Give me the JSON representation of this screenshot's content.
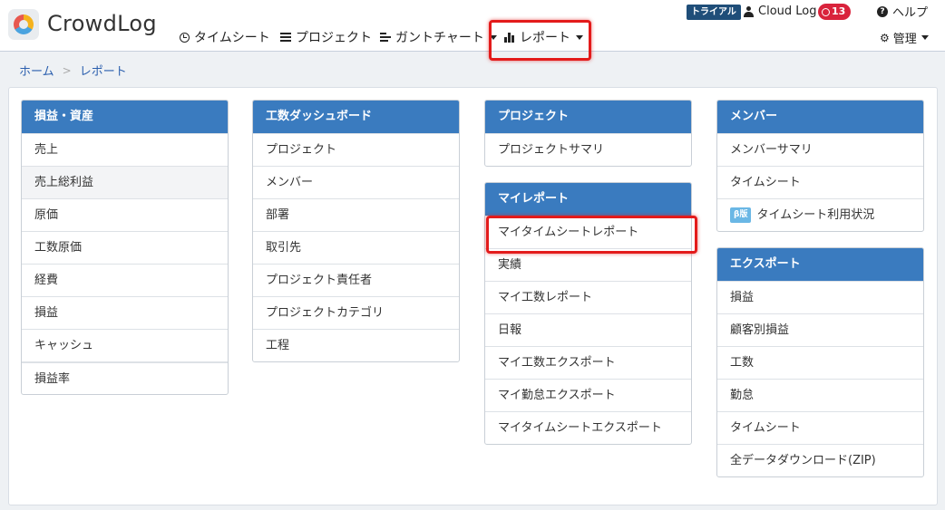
{
  "brand": {
    "name": "CrowdLog"
  },
  "nav": {
    "timesheet": "タイムシート",
    "project": "プロジェクト",
    "gantt": "ガントチャート",
    "report": "レポート"
  },
  "header": {
    "trial": "トライアル",
    "user": "Cloud Log",
    "badge_count": "13",
    "help": "ヘルプ",
    "admin": "管理"
  },
  "breadcrumb": {
    "home": "ホーム",
    "sep": ">",
    "current": "レポート"
  },
  "groups": {
    "pl": {
      "title": "損益・資産",
      "items": [
        "売上",
        "売上総利益",
        "原価",
        "工数原価",
        "経費",
        "損益",
        "キャッシュ",
        "損益率"
      ]
    },
    "dashboard": {
      "title": "工数ダッシュボード",
      "items": [
        "プロジェクト",
        "メンバー",
        "部署",
        "取引先",
        "プロジェクト責任者",
        "プロジェクトカテゴリ",
        "工程"
      ]
    },
    "project": {
      "title": "プロジェクト",
      "items": [
        "プロジェクトサマリ"
      ]
    },
    "myreport": {
      "title": "マイレポート",
      "items": [
        "マイタイムシートレポート",
        "実績",
        "マイ工数レポート",
        "日報",
        "マイ工数エクスポート",
        "マイ勤怠エクスポート",
        "マイタイムシートエクスポート"
      ]
    },
    "member": {
      "title": "メンバー",
      "items": [
        "メンバーサマリ",
        "タイムシート",
        "タイムシート利用状況"
      ],
      "beta_label": "β版"
    },
    "export": {
      "title": "エクスポート",
      "items": [
        "損益",
        "顧客別損益",
        "工数",
        "勤怠",
        "タイムシート",
        "全データダウンロード(ZIP)"
      ]
    }
  },
  "colors": {
    "header_blue": "#3a7bbf",
    "highlight_red": "#e31b1b",
    "trial_badge": "#1f4e79",
    "notification_badge": "#d9233c"
  }
}
